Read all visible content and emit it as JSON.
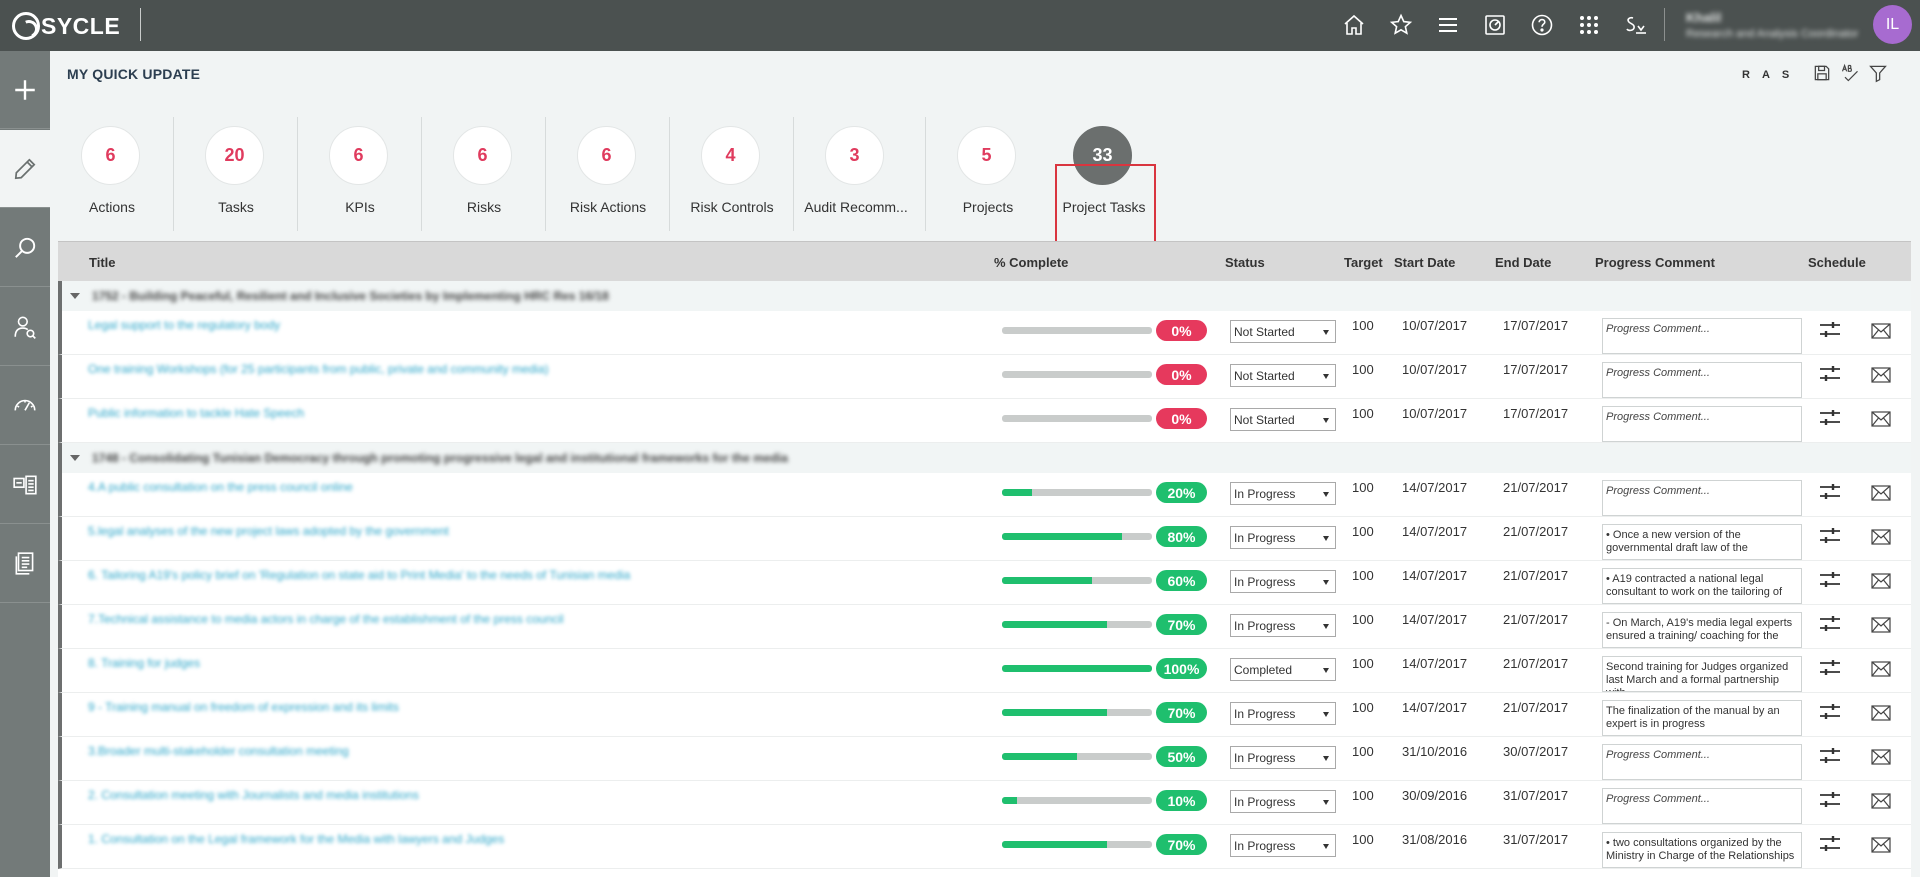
{
  "topbar": {
    "logo_text": "SYCLE",
    "icons": [
      "home-icon",
      "star-icon",
      "menu-icon",
      "dashboard-icon",
      "help-icon",
      "apps-grid-icon",
      "signature-icon"
    ],
    "user_name": "Khalil",
    "user_role": "Research and Analysis Coordinator",
    "avatar_initials": "IL",
    "avatar_color": "#a76bd0"
  },
  "sidebar": {
    "items": [
      "add-icon",
      "edit-icon",
      "search-icon",
      "user-search-icon",
      "gauge-icon",
      "id-card-icon",
      "documents-icon"
    ]
  },
  "page": {
    "title": "MY QUICK UPDATE",
    "ras": [
      "R",
      "A",
      "S"
    ]
  },
  "counters": [
    {
      "value": "6",
      "label": "Actions"
    },
    {
      "value": "20",
      "label": "Tasks"
    },
    {
      "value": "6",
      "label": "KPIs"
    },
    {
      "value": "6",
      "label": "Risks"
    },
    {
      "value": "6",
      "label": "Risk Actions"
    },
    {
      "value": "4",
      "label": "Risk Controls"
    },
    {
      "value": "3",
      "label": "Audit Recomm..."
    },
    {
      "value": "5",
      "label": "Projects"
    },
    {
      "value": "33",
      "label": "Project Tasks",
      "selected": true
    }
  ],
  "table": {
    "headers": {
      "title": "Title",
      "complete": "% Complete",
      "status": "Status",
      "target": "Target",
      "start": "Start Date",
      "end": "End Date",
      "comment": "Progress Comment",
      "schedule": "Schedule"
    },
    "groups": [
      {
        "title": "1752 - Building Peaceful, Resilient and Inclusive Societies by Implementing HRC Res 16/18",
        "rows": [
          {
            "title": "Legal support to the regulatory body",
            "pct": 0,
            "pct_label": "0%",
            "status": "Not Started",
            "target": "100",
            "start": "10/07/2017",
            "end": "17/07/2017",
            "comment": "Progress Comment...",
            "placeholder": true
          },
          {
            "title": "One training Workshops (for 25 participants from public, private and community media)",
            "pct": 0,
            "pct_label": "0%",
            "status": "Not Started",
            "target": "100",
            "start": "10/07/2017",
            "end": "17/07/2017",
            "comment": "Progress Comment...",
            "placeholder": true
          },
          {
            "title": "Public information to tackle Hate Speech",
            "pct": 0,
            "pct_label": "0%",
            "status": "Not Started",
            "target": "100",
            "start": "10/07/2017",
            "end": "17/07/2017",
            "comment": "Progress Comment...",
            "placeholder": true
          }
        ]
      },
      {
        "title": "1748 - Consolidating Tunisian Democracy through promoting progressive legal and institutional frameworks for the media",
        "rows": [
          {
            "title": "4.A public consultation on the press council online",
            "pct": 20,
            "pct_label": "20%",
            "status": "In Progress",
            "target": "100",
            "start": "14/07/2017",
            "end": "21/07/2017",
            "comment": "Progress Comment...",
            "placeholder": true
          },
          {
            "title": "5.legal analyses of the new project laws adopted by the government",
            "pct": 80,
            "pct_label": "80%",
            "status": "In Progress",
            "target": "100",
            "start": "14/07/2017",
            "end": "21/07/2017",
            "comment": "•      Once a new version of the governmental draft law of the",
            "placeholder": false
          },
          {
            "title": "6. Tailoring A19's policy brief on 'Regulation on state aid to Print Media' to the needs of Tunisian media",
            "pct": 60,
            "pct_label": "60%",
            "status": "In Progress",
            "target": "100",
            "start": "14/07/2017",
            "end": "21/07/2017",
            "comment": "•      A19 contracted a national legal consultant to work on the tailoring of",
            "placeholder": false
          },
          {
            "title": "7.Technical assistance to media actors in charge of the establishment of the press council",
            "pct": 70,
            "pct_label": "70%",
            "status": "In Progress",
            "target": "100",
            "start": "14/07/2017",
            "end": "21/07/2017",
            "comment": "- On March, A19's media legal experts ensured a training/ coaching for the",
            "placeholder": false
          },
          {
            "title": "8. Training for judges",
            "pct": 100,
            "pct_label": "100%",
            "status": "Completed",
            "target": "100",
            "start": "14/07/2017",
            "end": "21/07/2017",
            "comment": "Second training for Judges organized last March and a formal partnership with",
            "placeholder": false
          },
          {
            "title": "9 - Training manual on freedom of expression and its limits",
            "pct": 70,
            "pct_label": "70%",
            "status": "In Progress",
            "target": "100",
            "start": "14/07/2017",
            "end": "21/07/2017",
            "comment": "The finalization of the manual by an expert is in progress",
            "placeholder": false
          },
          {
            "title": "3.Broader multi-stakeholder consultation meeting",
            "pct": 50,
            "pct_label": "50%",
            "status": "In Progress",
            "target": "100",
            "start": "31/10/2016",
            "end": "30/07/2017",
            "comment": "Progress Comment...",
            "placeholder": true
          },
          {
            "title": "2. Consultation meeting with Journalists and media institutions",
            "pct": 10,
            "pct_label": "10%",
            "status": "In Progress",
            "target": "100",
            "start": "30/09/2016",
            "end": "31/07/2017",
            "comment": "Progress Comment...",
            "placeholder": true
          },
          {
            "title": "1. Consultation on the Legal framework for the Media with lawyers and Judges",
            "pct": 70,
            "pct_label": "70%",
            "status": "In Progress",
            "target": "100",
            "start": "31/08/2016",
            "end": "31/07/2017",
            "comment": "•      two consultations organized by the Ministry in Charge of the Relationships",
            "placeholder": false
          }
        ]
      }
    ]
  },
  "colors": {
    "topbar": "#4b5150",
    "sidebar": "#737a79",
    "accent_red": "#e6395d",
    "accent_green": "#1fbf6e",
    "link": "#2da6c9"
  }
}
